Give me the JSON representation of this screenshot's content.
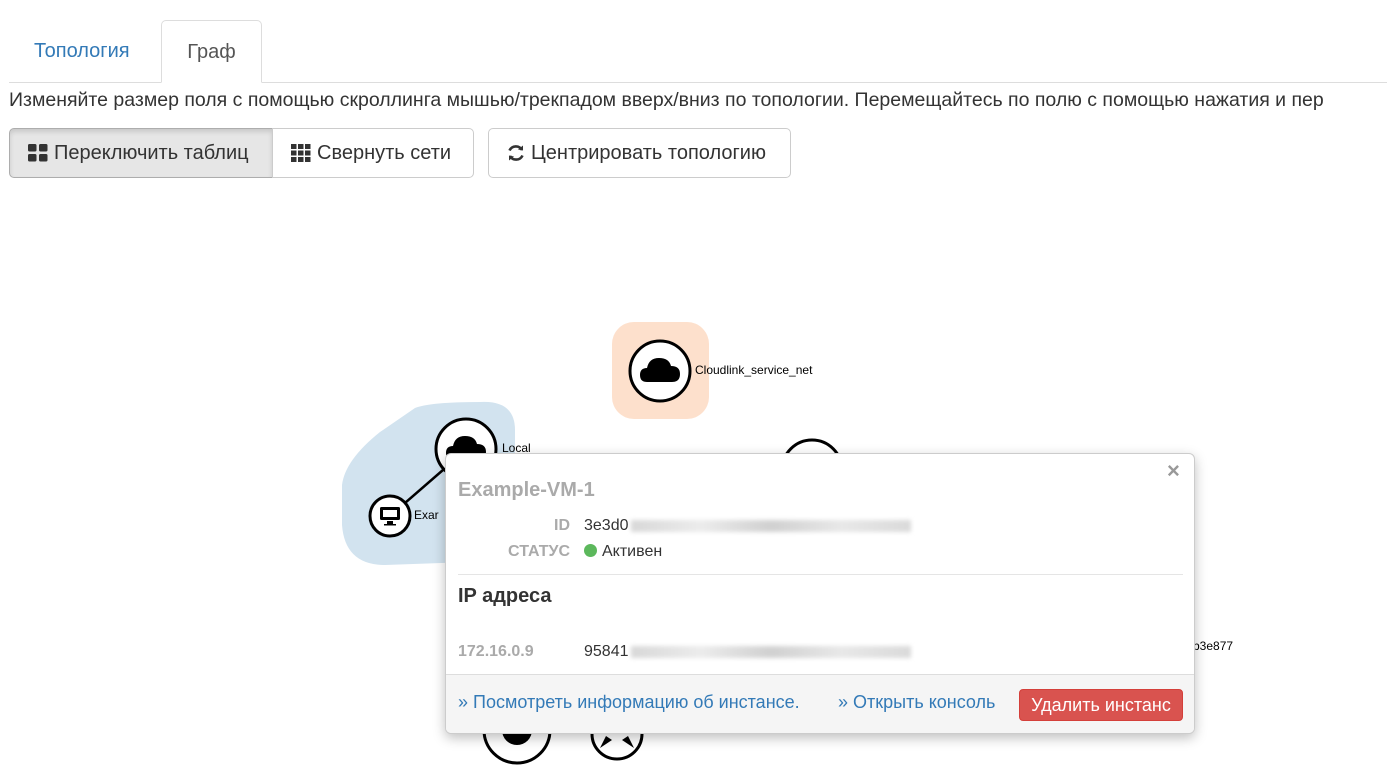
{
  "tabs": [
    {
      "label": "Топология",
      "active": false
    },
    {
      "label": "Граф",
      "active": true
    }
  ],
  "help_text": "Изменяйте размер поля с помощью скроллинга мышью/трекпадом вверх/вниз по топологии. Перемещайтесь по полю с помощью нажатия и пер",
  "toolbar": {
    "toggle_label": "Переключить таблиц",
    "collapse_label": "Свернуть сети",
    "center_label": "Центрировать топологию"
  },
  "graph": {
    "networks": [
      {
        "label": "Cloudlink_service_net",
        "color": "#fde0cc"
      },
      {
        "label": "Local",
        "color": "#d2e3ef"
      }
    ],
    "instance_label": "Exar",
    "partial_label": "b3e877"
  },
  "popup": {
    "title": "Example-VM-1",
    "close": "×",
    "id_label": "ID",
    "id_value": "3e3d0",
    "status_label": "СТАТУС",
    "status_value": "Активен",
    "status_color": "#5cb85c",
    "ip_title": "IP адреса",
    "ip_address": "172.16.0.9",
    "port_id": "95841",
    "view_link": "» Посмотреть информацию об инстансе.",
    "console_link": "» Открыть консоль",
    "delete_label": "Удалить инстанс"
  },
  "colors": {
    "link": "#337ab7",
    "danger": "#d9534f"
  }
}
